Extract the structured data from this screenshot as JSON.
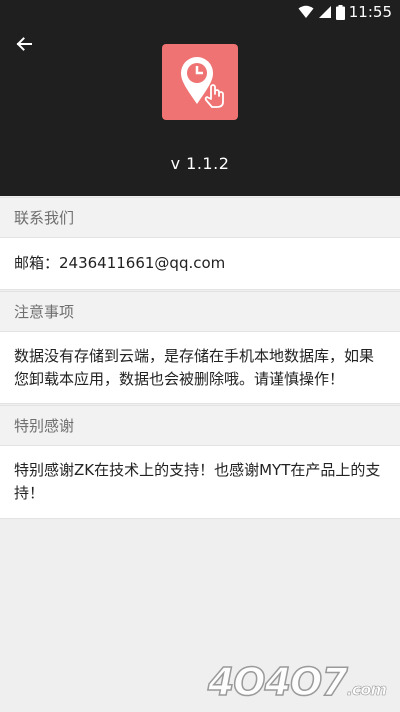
{
  "status_bar": {
    "time": "11:55"
  },
  "app": {
    "version": "v 1.1.2",
    "icon": "location-clock-touch-icon",
    "icon_color": "#ef7373"
  },
  "sections": [
    {
      "title": "联系我们",
      "body": "邮箱：2436411661@qq.com"
    },
    {
      "title": "注意事项",
      "body": "数据没有存储到云端，是存储在手机本地数据库，如果您卸载本应用，数据也会被删除哦。请谨慎操作！"
    },
    {
      "title": "特别感谢",
      "body": "特别感谢ZK在技术上的支持！也感谢MYT在产品上的支持！"
    }
  ],
  "watermark": {
    "text": "4O4O7",
    "suffix": ".com"
  }
}
